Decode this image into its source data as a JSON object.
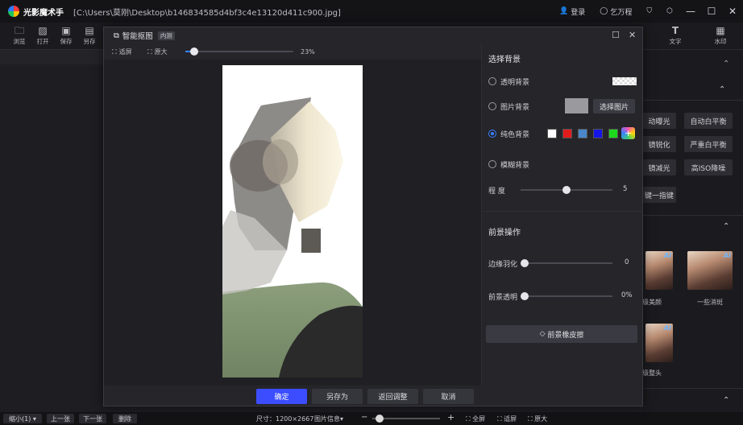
{
  "app": {
    "name": "光影魔术手",
    "file_path": "[C:\\Users\\莫刚\\Desktop\\b146834585d4bf3c4e13120d411c900.jpg]"
  },
  "titlebar": {
    "login": "登录",
    "ai_label": "乞万程",
    "icons": [
      "shirt-icon",
      "settings-hex-icon",
      "minimize-icon",
      "maximize-icon",
      "close-icon"
    ]
  },
  "toolbar": {
    "items": [
      {
        "icon": "folder-icon",
        "label": "浏览"
      },
      {
        "icon": "image-icon",
        "label": "打开"
      },
      {
        "icon": "save-icon",
        "label": "保存"
      },
      {
        "icon": "file-icon",
        "label": "另存"
      }
    ]
  },
  "right_panel": {
    "top_tools": [
      {
        "icon": "text-icon",
        "label": "文字"
      },
      {
        "icon": "watermark-icon",
        "label": "水印"
      }
    ],
    "buttons": [
      "动曝光",
      "自动白平衡",
      "镜锐化",
      "严重白平衡",
      "镜减光",
      "高ISO降噪",
      "键一指键"
    ],
    "thumbs": [
      {
        "caption": "级美颜"
      },
      {
        "caption": "一些消斑"
      },
      {
        "caption": "级整头"
      }
    ]
  },
  "statusbar": {
    "zoom_select": "缩小(1)",
    "prev": "上一张",
    "next": "下一张",
    "delete": "删除",
    "size": "尺寸：1200×2667",
    "info": "图片信息",
    "full": "全屏",
    "fit": "适屏",
    "actual": "原大"
  },
  "dialog": {
    "title": "智能抠图",
    "badge": "内测",
    "zoom": {
      "fit": "适屏",
      "original": "原大",
      "percent": "23%",
      "value": 0.08
    },
    "settings": {
      "bg_title": "选择背景",
      "transparent": "透明背景",
      "image_bg": "图片背景",
      "choose_image": "选择图片",
      "solid": "纯色背景",
      "blur": "模糊背景",
      "degree_label": "程 度",
      "degree": "5",
      "degree_value": 0.5,
      "colors": [
        "#ffffff",
        "#e21b1b",
        "#4a86c8",
        "#1515e6",
        "#1ed81e"
      ],
      "fg_title": "前景操作",
      "feather_label": "边缘羽化",
      "feather": "0",
      "opacity_label": "前景透明",
      "opacity": "0%",
      "eraser": "前景橡皮擦"
    },
    "footer": {
      "ok": "确定",
      "save_as": "另存为",
      "back": "返回调整",
      "cancel": "取消"
    }
  }
}
